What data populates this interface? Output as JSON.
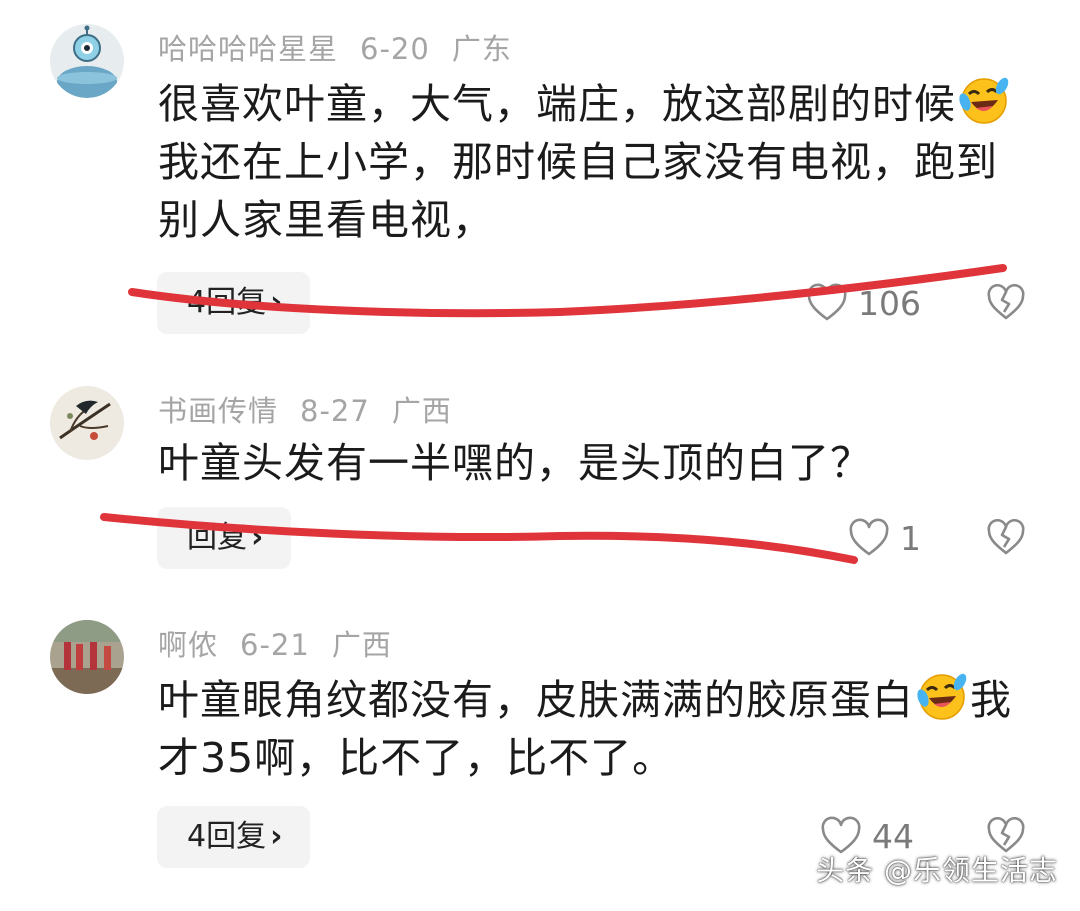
{
  "comments": [
    {
      "username": "哈哈哈哈星星",
      "date": "6-20",
      "location": "广东",
      "text_line1": "很喜欢叶童，大气，端庄，放这部剧的时候",
      "text_line2": "我还在上小学，那时候自己家没有电视，跑到",
      "text_line3": "别人家里看电视，",
      "emoji": "laughing-crying-emoji",
      "reply_label": "4回复",
      "likes": "106"
    },
    {
      "username": "书画传情",
      "date": "8-27",
      "location": "广西",
      "text_line1": "叶童头发有一半嘿的，是头顶的白了？",
      "reply_label": "回复",
      "likes": "1"
    },
    {
      "username": "啊侬",
      "date": "6-21",
      "location": "广西",
      "text_line1": "叶童眼角纹都没有，皮肤满满的胶原蛋白",
      "text_line1_after": "我",
      "text_line2": "才35啊，比不了，比不了。",
      "emoji": "laughing-crying-emoji",
      "reply_label": "4回复",
      "likes": "44"
    }
  ],
  "chevron": "›",
  "icons": {
    "like": "heart-outline-icon",
    "dislike": "broken-heart-icon"
  },
  "colors": {
    "strike": "#e0343b",
    "meta": "#a5a5a5",
    "text": "#1b1b1b",
    "reply_bg": "#f3f3f3"
  },
  "watermark": "头条 @乐领生活志"
}
